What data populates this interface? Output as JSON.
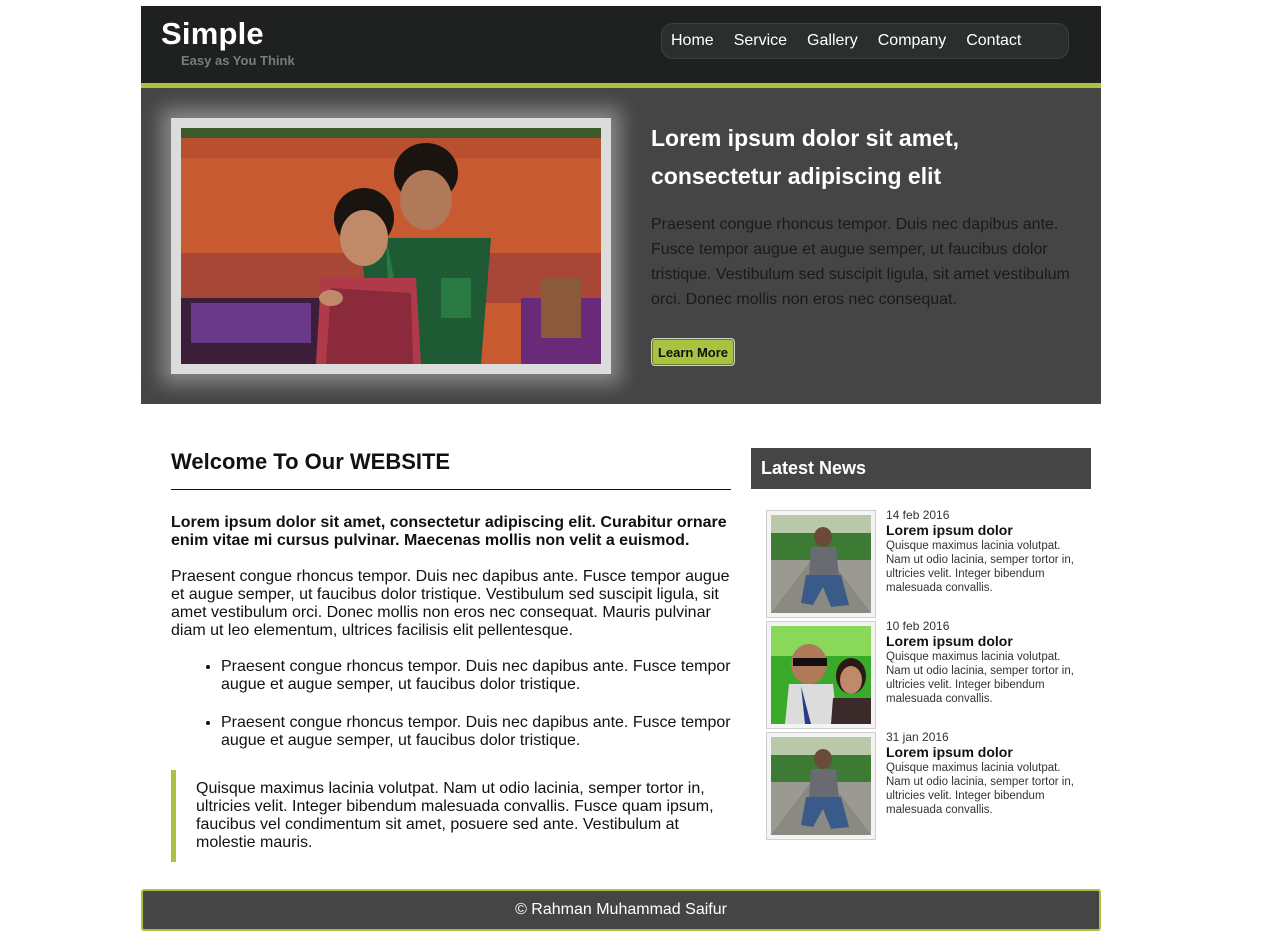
{
  "header": {
    "logo": "Simple",
    "tagline": "Easy as You Think",
    "nav": [
      "Home",
      "Service",
      "Gallery",
      "Company",
      "Contact"
    ]
  },
  "hero": {
    "title": "Lorem ipsum dolor sit amet, consectetur adipiscing elit",
    "text": "Praesent congue rhoncus tempor. Duis nec dapibus ante. Fusce tempor augue et augue semper, ut faucibus dolor tristique. Vestibulum sed suscipit ligula, sit amet vestibulum orci. Donec mollis non eros nec consequat.",
    "button": "Learn More"
  },
  "main": {
    "heading": "Welcome To Our WEBSITE",
    "lead": "Lorem ipsum dolor sit amet, consectetur adipiscing elit. Curabitur ornare enim vitae mi cursus pulvinar. Maecenas mollis non velit a euismod.",
    "paragraph": "Praesent congue rhoncus tempor. Duis nec dapibus ante. Fusce tempor augue et augue semper, ut faucibus dolor tristique. Vestibulum sed suscipit ligula, sit amet vestibulum orci. Donec mollis non eros nec consequat. Mauris pulvinar diam ut leo elementum, ultrices facilisis elit pellentesque.",
    "bullets": [
      "Praesent congue rhoncus tempor. Duis nec dapibus ante. Fusce tempor augue et augue semper, ut faucibus dolor tristique.",
      "Praesent congue rhoncus tempor. Duis nec dapibus ante. Fusce tempor augue et augue semper, ut faucibus dolor tristique."
    ],
    "quote": "Quisque maximus lacinia volutpat. Nam ut odio lacinia, semper tortor in, ultricies velit. Integer bibendum malesuada convallis. Fusce quam ipsum, faucibus vel condimentum sit amet, posuere sed ante. Vestibulum at molestie mauris."
  },
  "sidebar": {
    "title": "Latest News",
    "items": [
      {
        "date": "14 feb 2016",
        "title": "Lorem ipsum dolor",
        "text": "Quisque maximus lacinia volutpat. Nam ut odio lacinia, semper tortor in, ultricies velit. Integer bibendum malesuada convallis."
      },
      {
        "date": "10 feb 2016",
        "title": "Lorem ipsum dolor",
        "text": "Quisque maximus lacinia volutpat. Nam ut odio lacinia, semper tortor in, ultricies velit. Integer bibendum malesuada convallis."
      },
      {
        "date": "31 jan 2016",
        "title": "Lorem ipsum dolor",
        "text": "Quisque maximus lacinia volutpat. Nam ut odio lacinia, semper tortor in, ultricies velit. Integer bibendum malesuada convallis."
      }
    ]
  },
  "footer": {
    "text": "© Rahman Muhammad Saifur"
  },
  "colors": {
    "accent": "#a9c23f",
    "header_bg": "#1e2120",
    "panel_bg": "#454545"
  }
}
